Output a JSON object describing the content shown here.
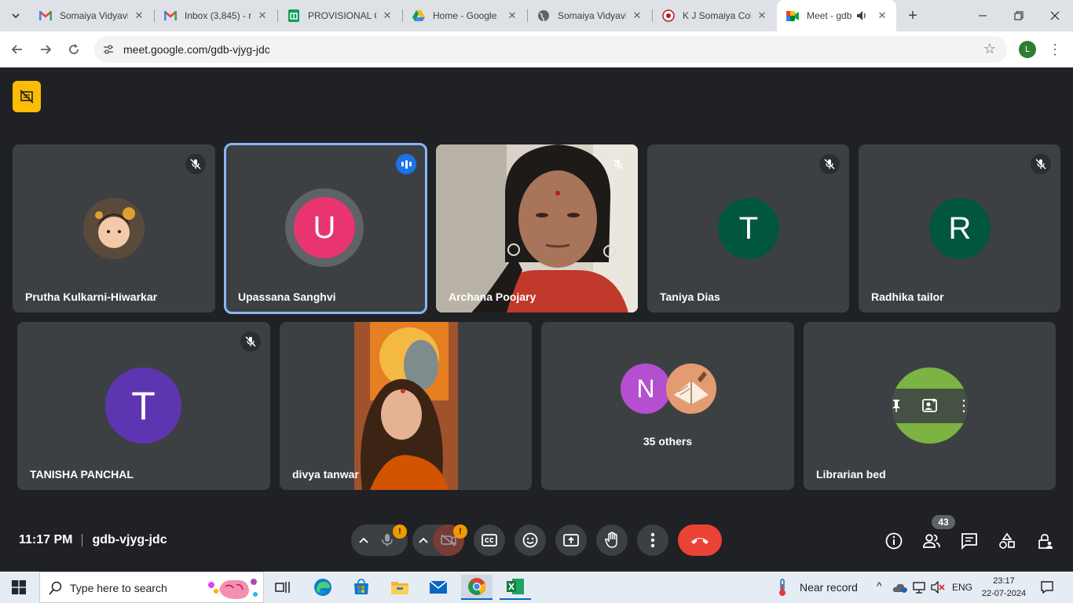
{
  "browser": {
    "tabs": [
      {
        "title": "Somaiya Vidyavi",
        "icon": "gmail-icon"
      },
      {
        "title": "Inbox (3,845) - n",
        "icon": "gmail-icon"
      },
      {
        "title": "PROVISIONAL C",
        "icon": "sheets-icon"
      },
      {
        "title": "Home - Google",
        "icon": "drive-icon"
      },
      {
        "title": "Somaiya Vidyavi",
        "icon": "globe-icon"
      },
      {
        "title": "K J Somaiya Coll",
        "icon": "college-icon"
      },
      {
        "title": "Meet - gdb-",
        "icon": "meet-icon",
        "active": true
      }
    ],
    "url": "meet.google.com/gdb-vjyg-jdc",
    "profile_initial": "L"
  },
  "meet": {
    "participants_row1": [
      {
        "name": "Prutha Kulkarni-Hiwarkar",
        "muted": true,
        "avatar": "photo"
      },
      {
        "name": "Upassana Sanghvi",
        "speaking": true,
        "initial": "U",
        "color": "#e8356f"
      },
      {
        "name": "Archana Poojary",
        "muted": true,
        "avatar": "video"
      },
      {
        "name": "Taniya Dias",
        "muted": true,
        "initial": "T",
        "color": "#00563f"
      },
      {
        "name": "Radhika tailor",
        "muted": true,
        "initial": "R",
        "color": "#00563f"
      }
    ],
    "participants_row2": [
      {
        "name": "TANISHA PANCHAL",
        "muted": true,
        "initial": "T",
        "color": "#5e35b1"
      },
      {
        "name": "divya tanwar",
        "avatar": "video"
      },
      {
        "name": "35 others",
        "initial": "N",
        "color": "#b44fcf"
      },
      {
        "name": "Librarian bed",
        "color": "#7cb342"
      }
    ],
    "time": "11:17 PM",
    "meeting_code": "gdb-vjyg-jdc",
    "alert_glyph": "!",
    "people_count": "43"
  },
  "taskbar": {
    "search_placeholder": "Type here to search",
    "weather": "Near record",
    "lang": "ENG",
    "time": "23:17",
    "date": "22-07-2024"
  }
}
